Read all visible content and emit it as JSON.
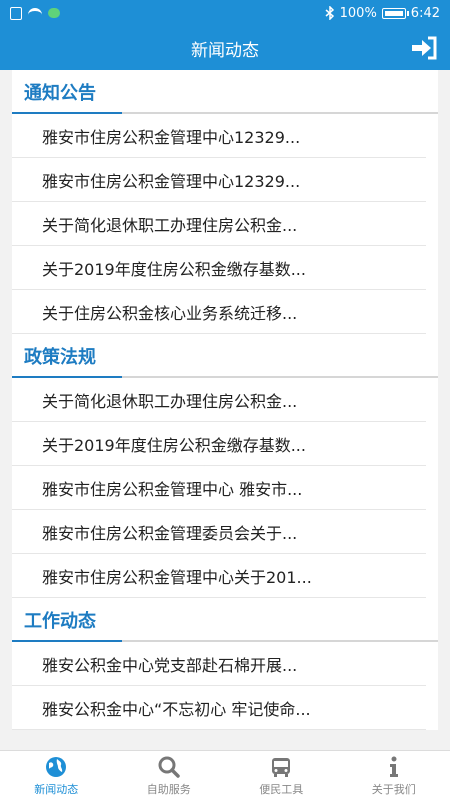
{
  "statusbar": {
    "battery": "100%",
    "time": "6:42"
  },
  "appbar": {
    "title": "新闻动态"
  },
  "sections": [
    {
      "title": "通知公告",
      "items": [
        "雅安市住房公积金管理中心12329...",
        "雅安市住房公积金管理中心12329...",
        "关于简化退休职工办理住房公积金...",
        "关于2019年度住房公积金缴存基数...",
        "关于住房公积金核心业务系统迁移..."
      ]
    },
    {
      "title": "政策法规",
      "items": [
        "关于简化退休职工办理住房公积金...",
        "关于2019年度住房公积金缴存基数...",
        "雅安市住房公积金管理中心 雅安市...",
        "雅安市住房公积金管理委员会关于...",
        "雅安市住房公积金管理中心关于201..."
      ]
    },
    {
      "title": "工作动态",
      "items": [
        "雅安公积金中心党支部赴石棉开展...",
        "雅安公积金中心“不忘初心 牢记使命..."
      ]
    }
  ],
  "tabs": [
    {
      "label": "新闻动态",
      "icon": "globe-icon"
    },
    {
      "label": "自助服务",
      "icon": "search-icon"
    },
    {
      "label": "便民工具",
      "icon": "bus-icon"
    },
    {
      "label": "关于我们",
      "icon": "info-icon"
    }
  ],
  "colors": {
    "primary": "#1e8fd6",
    "section_title": "#1e7cc2"
  }
}
